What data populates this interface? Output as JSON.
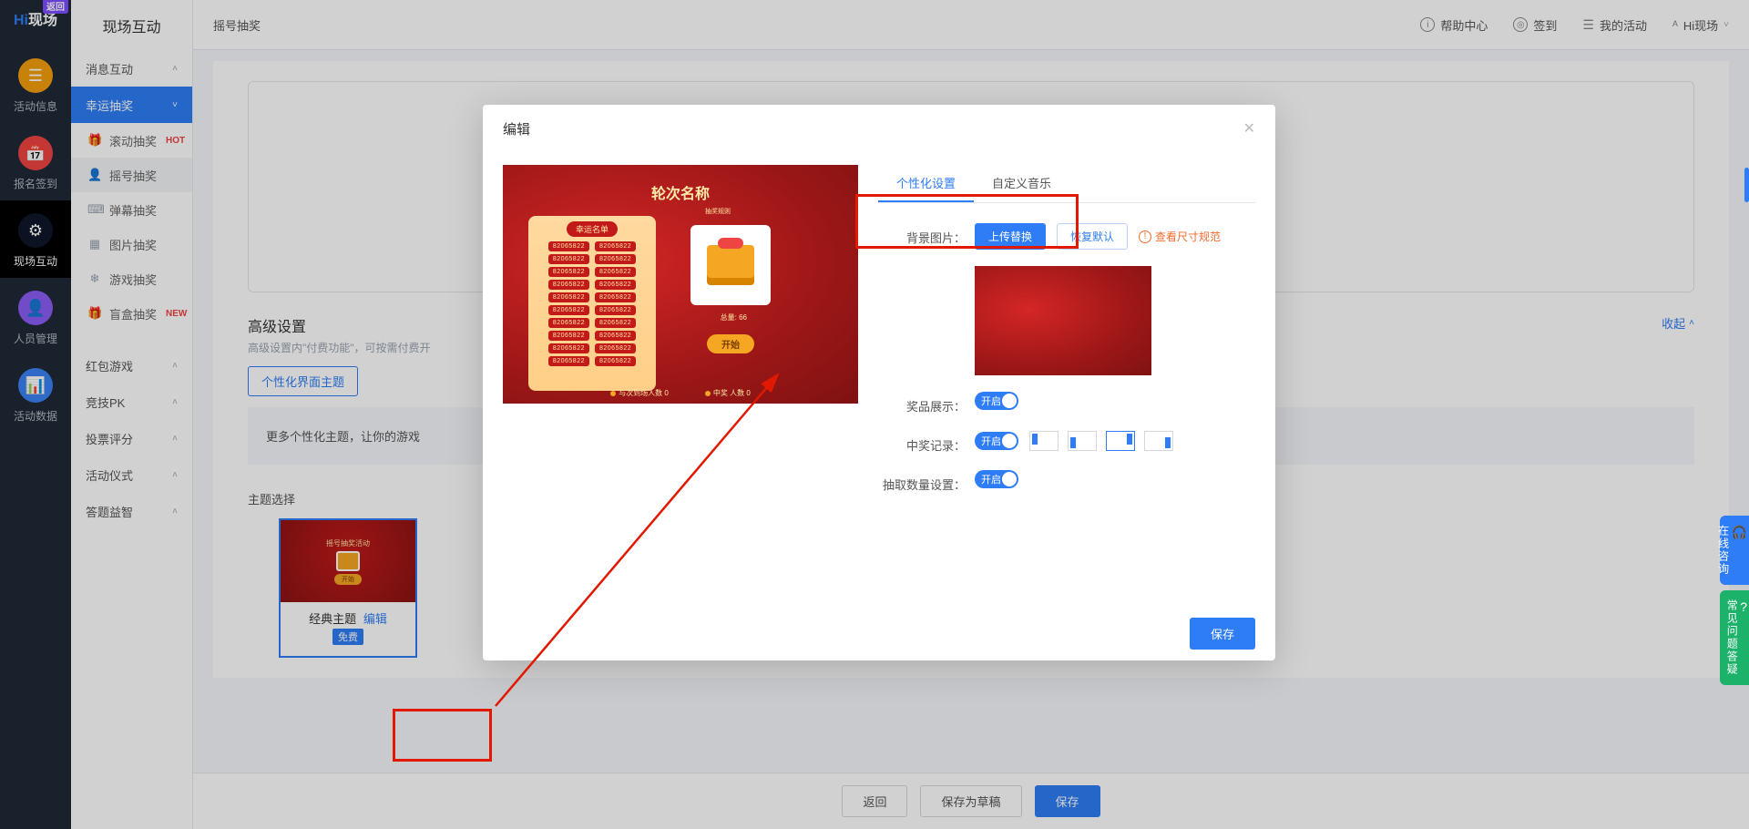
{
  "brand": {
    "hi": "Hi",
    "rest": "现场",
    "return_badge": "返回"
  },
  "leftnav": [
    {
      "label": "活动信息"
    },
    {
      "label": "报名签到"
    },
    {
      "label": "现场互动"
    },
    {
      "label": "人员管理"
    },
    {
      "label": "活动数据"
    }
  ],
  "sidebar": {
    "title": "现场互动",
    "groups": {
      "msg": {
        "label": "消息互动"
      },
      "lucky": {
        "label": "幸运抽奖"
      },
      "redpack": {
        "label": "红包游戏"
      },
      "pk": {
        "label": "竞技PK"
      },
      "vote": {
        "label": "投票评分"
      },
      "ceremony": {
        "label": "活动仪式"
      },
      "quiz": {
        "label": "答题益智"
      }
    },
    "lucky_items": [
      {
        "label": "滚动抽奖",
        "badge": "HOT"
      },
      {
        "label": "摇号抽奖"
      },
      {
        "label": "弹幕抽奖"
      },
      {
        "label": "图片抽奖"
      },
      {
        "label": "游戏抽奖"
      },
      {
        "label": "盲盒抽奖",
        "badge": "NEW"
      }
    ]
  },
  "topbar": {
    "breadcrumb": "摇号抽奖",
    "help": "帮助中心",
    "checkin": "签到",
    "myact": "我的活动",
    "user": "Hi现场"
  },
  "page": {
    "adv_title": "高级设置",
    "adv_sub": "高级设置内\"付费功能\"，可按需付费开",
    "theme_tab": "个性化界面主题",
    "banner": "更多个性化主题，让你的游戏",
    "theme_select": "主题选择",
    "collapse": "收起",
    "theme_card": {
      "tiny_title": "摇号抽奖活动",
      "go": "开始",
      "name": "经典主题",
      "edit": "编辑",
      "free": "免费"
    }
  },
  "bottom": {
    "back": "返回",
    "draft": "保存为草稿",
    "save": "保存"
  },
  "modal": {
    "title": "编辑",
    "tabs": {
      "personal": "个性化设置",
      "music": "自定义音乐"
    },
    "labels": {
      "bg": "背景图片：",
      "prize_show": "奖品展示：",
      "record": "中奖记录：",
      "count": "抽取数量设置："
    },
    "btns": {
      "upload": "上传替换",
      "reset": "恢复默认",
      "save": "保存"
    },
    "size_hint": "查看尺寸规范",
    "toggle_on": "开启",
    "preview": {
      "round_title": "轮次名称",
      "sub": "抽奖规则",
      "panel_tag": "幸运名单",
      "num": "82065822",
      "count": "总量: 66",
      "start": "开始",
      "stat1": "与次到场人数",
      "stat1_v": "0",
      "stat2": "中奖 人数",
      "stat2_v": "0"
    }
  },
  "float": {
    "online": "在线咨询",
    "faq": "常见问题答疑"
  }
}
